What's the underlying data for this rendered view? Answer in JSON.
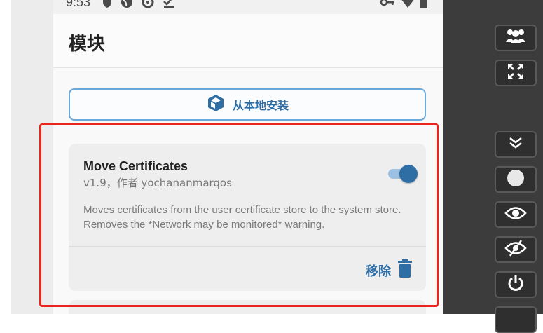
{
  "status_bar": {
    "time": "9:53",
    "left_icons": [
      "shield-icon",
      "globe-icon",
      "sync-icon",
      "check-list-icon"
    ],
    "right_icons": [
      "vpn-key-icon",
      "wifi-icon",
      "battery-icon"
    ]
  },
  "app_bar": {
    "title": "模块"
  },
  "install_button": {
    "label": "从本地安装",
    "icon": "cube-icon"
  },
  "module": {
    "name": "Move Certificates",
    "meta": "v1.9，作者 yochananmarqos",
    "description": "Moves certificates from the user certificate store to the system store. Removes the *Network may be monitored* warning.",
    "enabled": true,
    "remove_label": "移除",
    "remove_icon": "trash-icon"
  },
  "emulator_toolbar": {
    "buttons": [
      "multi-user-icon",
      "fullscreen-icon",
      "collapse-icon",
      "record-icon",
      "eye-icon",
      "eye-off-icon",
      "power-icon"
    ]
  },
  "colors": {
    "accent": "#2f6ea5",
    "accent_light": "#9cc1e3",
    "highlight": "#e8251e",
    "toolbar_bg": "#3c3c3c"
  }
}
